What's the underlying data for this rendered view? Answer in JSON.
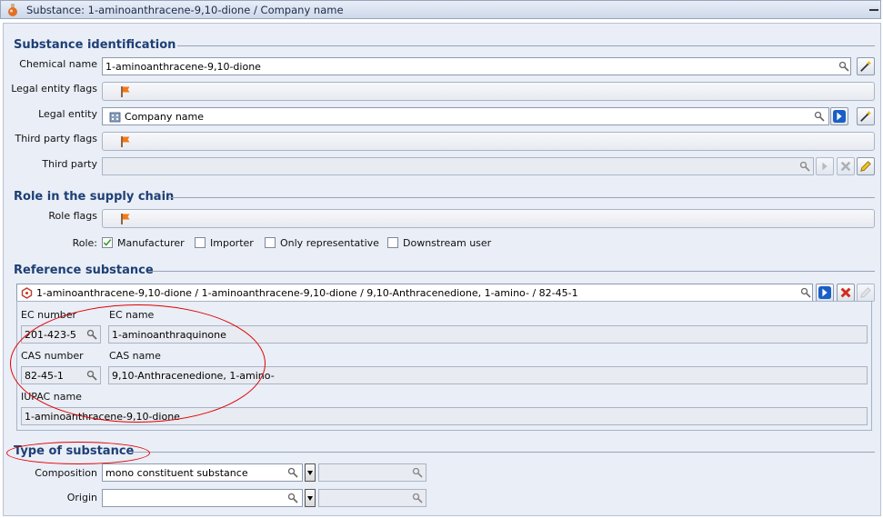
{
  "window": {
    "title": "Substance: 1-aminoanthracene-9,10-dione / Company name"
  },
  "identification": {
    "heading": "Substance identification",
    "chemical_name_label": "Chemical name",
    "chemical_name_value": "1-aminoanthracene-9,10-dione",
    "legal_entity_flags_label": "Legal entity flags",
    "legal_entity_label": "Legal entity",
    "legal_entity_value": "Company name",
    "third_party_flags_label": "Third party flags",
    "third_party_label": "Third party",
    "third_party_value": ""
  },
  "supply_chain": {
    "heading": "Role in the supply chain",
    "role_flags_label": "Role flags",
    "role_label": "Role:",
    "roles": [
      {
        "label": "Manufacturer",
        "checked": true
      },
      {
        "label": "Importer",
        "checked": false
      },
      {
        "label": "Only representative",
        "checked": false
      },
      {
        "label": "Downstream user",
        "checked": false
      }
    ]
  },
  "reference": {
    "heading": "Reference substance",
    "value": "1-aminoanthracene-9,10-dione / 1-aminoanthracene-9,10-dione / 9,10-Anthracenedione, 1-amino- / 82-45-1",
    "ec_number_label": "EC number",
    "ec_number_value": "201-423-5",
    "ec_name_label": "EC name",
    "ec_name_value": "1-aminoanthraquinone",
    "cas_number_label": "CAS number",
    "cas_number_value": "82-45-1",
    "cas_name_label": "CAS name",
    "cas_name_value": "9,10-Anthracenedione, 1-amino-",
    "iupac_name_label": "IUPAC name",
    "iupac_name_value": "1-aminoanthracene-9,10-dione"
  },
  "type": {
    "heading": "Type of substance",
    "composition_label": "Composition",
    "composition_value": "mono constituent substance",
    "composition_extra": "",
    "origin_label": "Origin",
    "origin_value": "",
    "origin_extra": ""
  },
  "colors": {
    "annotation": "#e00000",
    "heading": "#1e3f74",
    "go_button": "#1a5fc8",
    "delete_button": "#d42a1a"
  }
}
